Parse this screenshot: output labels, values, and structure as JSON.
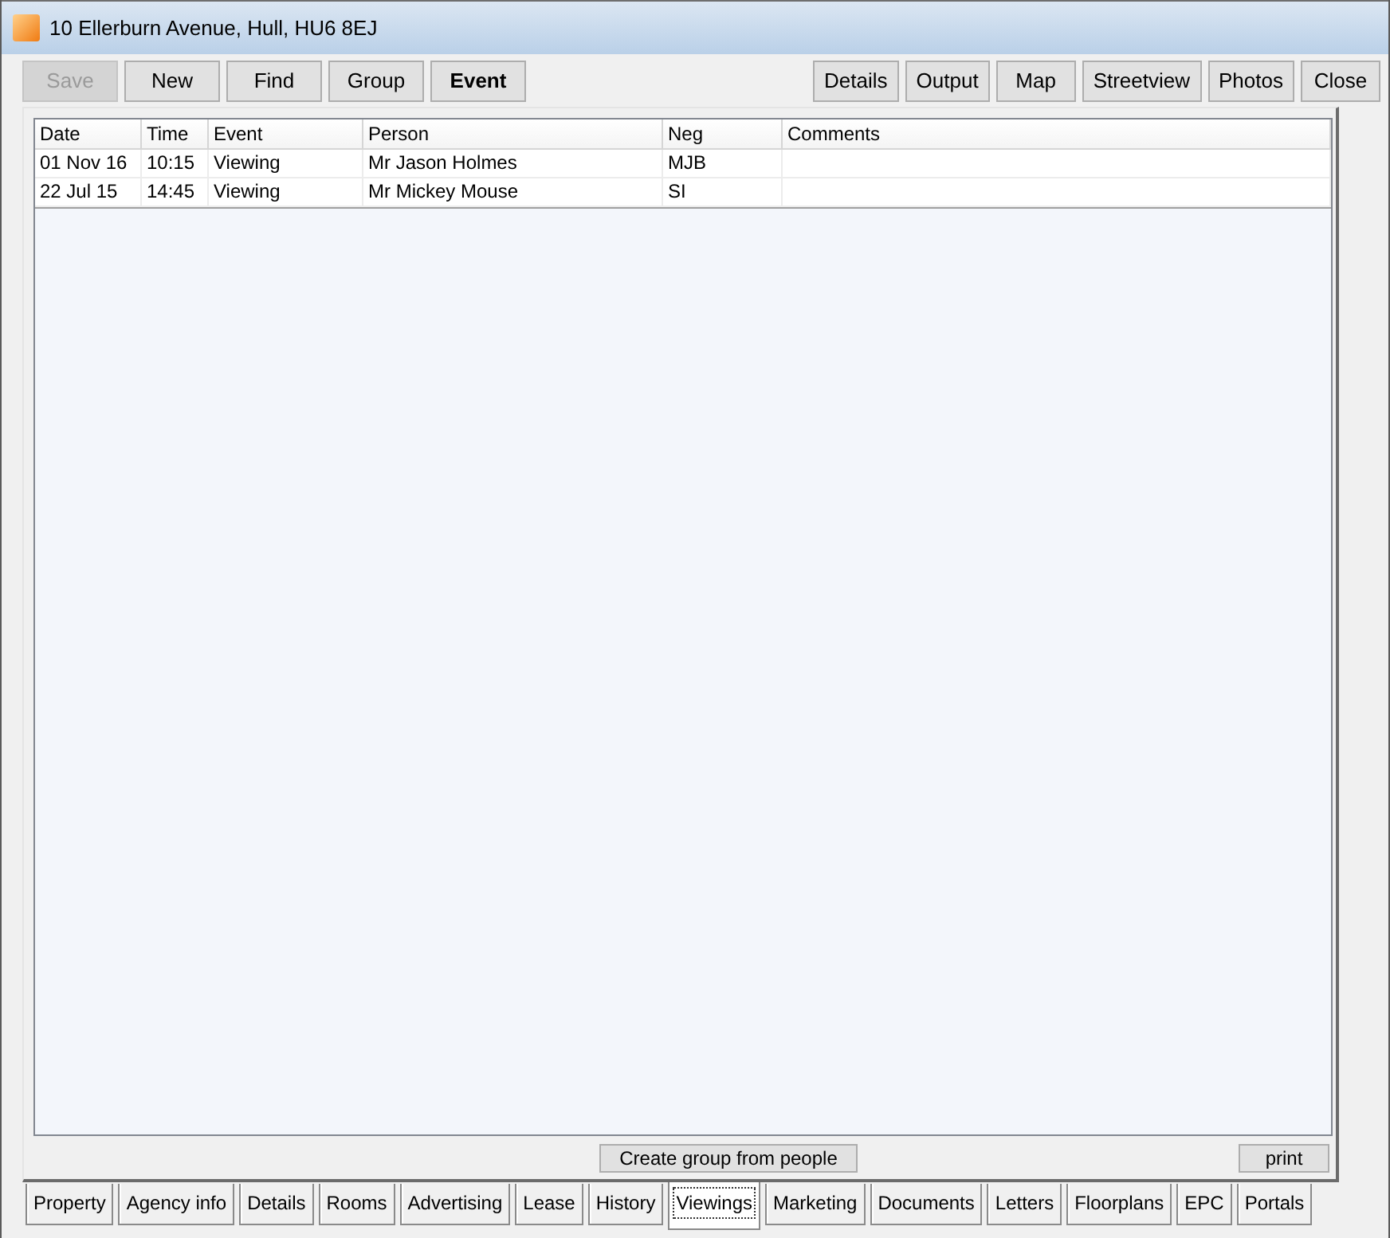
{
  "window": {
    "title": "10 Ellerburn Avenue, Hull, HU6 8EJ"
  },
  "toolbar": {
    "left": [
      {
        "label": "Save",
        "disabled": true,
        "selected": false
      },
      {
        "label": "New",
        "disabled": false,
        "selected": false
      },
      {
        "label": "Find",
        "disabled": false,
        "selected": false
      },
      {
        "label": "Group",
        "disabled": false,
        "selected": false
      },
      {
        "label": "Event",
        "disabled": false,
        "selected": true
      }
    ],
    "right": [
      "Details",
      "Output",
      "Map",
      "Streetview",
      "Photos",
      "Close"
    ]
  },
  "table": {
    "columns": [
      "Date",
      "Time",
      "Event",
      "Person",
      "Neg",
      "Comments"
    ],
    "rows": [
      [
        "01 Nov 16",
        "10:15",
        "Viewing",
        "Mr Jason Holmes",
        "MJB"
      ],
      [
        "22 Jul 15",
        "14:45",
        "Viewing",
        "Mr Mickey Mouse",
        "SI"
      ]
    ]
  },
  "actions": {
    "left": "Create group from people",
    "right": "print"
  },
  "tabs": [
    {
      "label": "Property",
      "selected": false
    },
    {
      "label": "Agency info",
      "selected": false
    },
    {
      "label": "Details",
      "selected": false
    },
    {
      "label": "Rooms",
      "selected": false
    },
    {
      "label": "Advertising",
      "selected": false
    },
    {
      "label": "Lease",
      "selected": false
    },
    {
      "label": "History",
      "selected": false
    },
    {
      "label": "Viewings",
      "selected": true
    },
    {
      "label": "Marketing",
      "selected": false
    },
    {
      "label": "Documents",
      "selected": false
    },
    {
      "label": "Letters",
      "selected": false
    },
    {
      "label": "Floorplans",
      "selected": false
    },
    {
      "label": "EPC",
      "selected": false
    },
    {
      "label": "Portals",
      "selected": false
    }
  ]
}
